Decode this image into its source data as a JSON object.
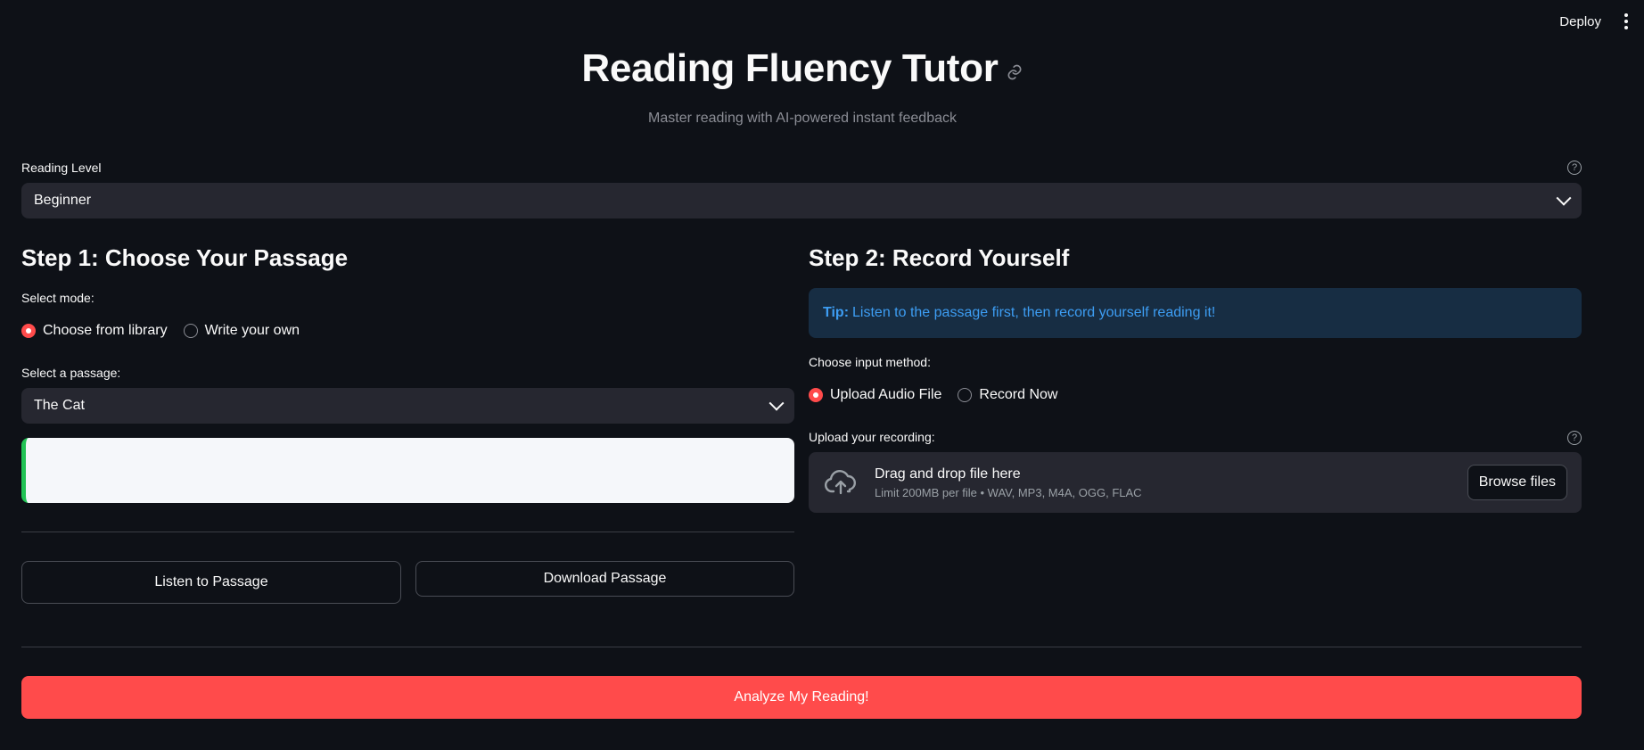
{
  "topbar": {
    "deploy_label": "Deploy"
  },
  "header": {
    "title": "Reading Fluency Tutor",
    "subtitle": "Master reading with AI-powered instant feedback"
  },
  "reading_level": {
    "label": "Reading Level",
    "value": "Beginner"
  },
  "step1": {
    "title": "Step 1: Choose Your Passage",
    "mode_label": "Select mode:",
    "modes": [
      "Choose from library",
      "Write your own"
    ],
    "selected_mode": "Choose from library",
    "passage_label": "Select a passage:",
    "passage_value": "The Cat",
    "listen_label": "Listen to Passage",
    "download_label": "Download Passage"
  },
  "step2": {
    "title": "Step 2: Record Yourself",
    "tip_prefix": "Tip:",
    "tip_text": "Listen to the passage first, then record yourself reading it!",
    "method_label": "Choose input method:",
    "methods": [
      "Upload Audio File",
      "Record Now"
    ],
    "selected_method": "Upload Audio File",
    "upload_label": "Upload your recording:",
    "drop_text": "Drag and drop file here",
    "limit_text": "Limit 200MB per file • WAV, MP3, M4A, OGG, FLAC",
    "browse_label": "Browse files"
  },
  "analyze_label": "Analyze My Reading!",
  "colors": {
    "background": "#0e1117",
    "accent": "#ff4b4b",
    "input_bg": "#262730",
    "info_bg": "#172d43",
    "info_text": "#3d9df3",
    "success_bar": "#21c354"
  }
}
